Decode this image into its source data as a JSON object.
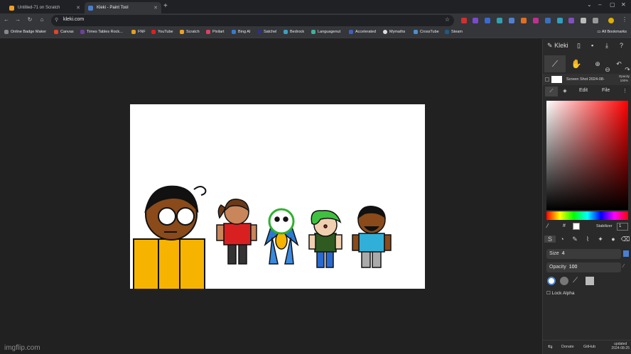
{
  "tabs": [
    {
      "label": "Untitled-71 on Scratch",
      "favicon_color": "#f0a020"
    },
    {
      "label": "Kleki - Paint Tool",
      "favicon_color": "#4a7fd0"
    }
  ],
  "address": {
    "url": "kleki.com"
  },
  "bookmarks": [
    {
      "label": "Online Badge Maker",
      "color": "#888888"
    },
    {
      "label": "Canvas",
      "color": "#e0452a"
    },
    {
      "label": "Times Tables Rock...",
      "color": "#7040a0"
    },
    {
      "label": "FNF",
      "color": "#e0a020"
    },
    {
      "label": "YouTube",
      "color": "#e02020"
    },
    {
      "label": "Scratch",
      "color": "#f0a020"
    },
    {
      "label": "Pixilart",
      "color": "#e04060"
    },
    {
      "label": "Bing AI",
      "color": "#3a7ad0"
    },
    {
      "label": "Satchel",
      "color": "#303080"
    },
    {
      "label": "Bedrock",
      "color": "#3aa0c0"
    },
    {
      "label": "Languagenut",
      "color": "#40b0a0"
    },
    {
      "label": "Accelerated",
      "color": "#4060c0"
    },
    {
      "label": "Mymaths",
      "color": "#dddddd"
    },
    {
      "label": "CrossTube",
      "color": "#4a90d0"
    },
    {
      "label": "Steam",
      "color": "#1b5a8a"
    }
  ],
  "all_bookmarks": "All Bookmarks",
  "kleki": {
    "logo": "Kleki",
    "layer_name": "Screen Shot 2024-08-",
    "layer_opacity_label": "Opacity",
    "layer_opacity_value": "100%",
    "tab_edit": "Edit",
    "tab_file": "File",
    "hash": "#",
    "stabilizer_label": "Stabilizer",
    "stabilizer_value": "1",
    "size_label": "Size",
    "size_value": "4",
    "opacity_label": "Opacity",
    "opacity_value": "100",
    "lock_alpha": "Lock Alpha",
    "donate": "Donate",
    "github": "GitHub",
    "updated_label": "updated",
    "updated_date": "2024-08-25"
  },
  "watermark": "imgflip.com",
  "colors": {
    "canvas": "#ffffff",
    "primary": "#ffffff",
    "accent": "#e8a800"
  }
}
